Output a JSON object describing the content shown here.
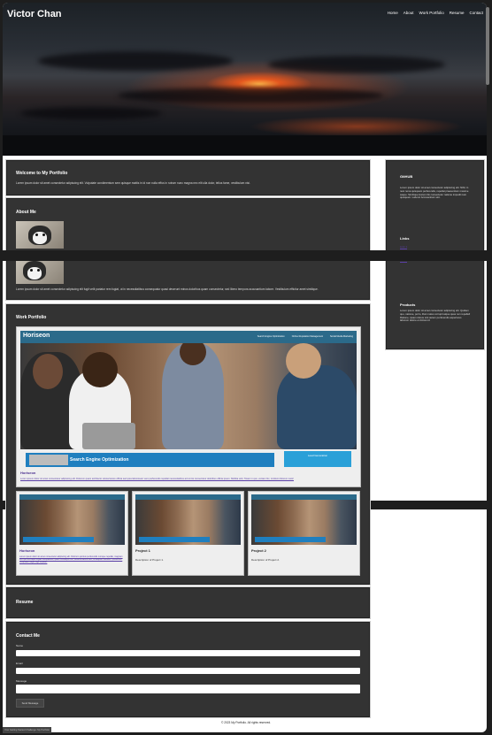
{
  "site": {
    "brand": "Victor Chan",
    "nav": [
      "Home",
      "About",
      "Work Portfolio",
      "Resume",
      "Contact"
    ]
  },
  "welcome": {
    "title": "Welcome to My Portfolio",
    "text": "Lorem ipsum dolor sit amet consectetur adipiscing elit. Vulputate condimentum sem quisque mattis in id non nulla effus in rutrum nunc magna nec elit ulla dolor, tellus fame, vestibulum nisi."
  },
  "about": {
    "title": "About Me",
    "text": "Lorem ipsum dolor sit amet consectetur adipiscing elit fugit velit pariatur rem fugiat, ut in necessitatibus consequatur quasi deserunt minus doloribus quam consectetur, sed libero tempora accusantium labore. Vestibulum efficitur amet similique."
  },
  "sidebar": {
    "github_title": "GitHUB",
    "github_text": "Lorem ipsum dolor sit amet consectetur adipiscing elit. Nihil, in nesi rema quisquam perferendis, repellat praesentium maxime saepe. Similique Harum illo consectetur natione impedit nam quisquam. Labore! Accusantium sint.",
    "links_title": "Links",
    "links": [
      "Link 1",
      "Link 2",
      "Link 3",
      "Link 4"
    ],
    "products_title": "Products",
    "products_text": "Lorem ipsum dolor sit amet consectetur adipiscing elit. Quidem quo, natione, porro, illum natus corrupti atque quas non repellat! Ratione, ipsam dolore sint autem perferendis asperiores laborum dolore et dictorum!"
  },
  "portfolio": {
    "title": "Work Portfolio",
    "shot_brand": "Horiseon",
    "shot_nav": [
      "Search Engine Optimization",
      "Online Reputation Management",
      "Social Media Marketing"
    ],
    "shot_cta": "Search Engine Optimization",
    "shot_cta2": "Lead Generation",
    "featured_name": "Horiseon",
    "featured_text": "Lorem ipsum dolor sit amet consectetur adipiscing elit. Dolorum quam architecto soluta facere officia sed quia laboriosam vero perferendis repellat necessitatibus ad omnis consectetur doloribus officia ipsum. Mollitia velit, Totam in quo, veniam hic, incidunt dolorem iusto!",
    "projects": [
      {
        "name": "Horiseon",
        "desc": "Lorem ipsum dolor sit amet consectetur adipiscing elit. Dolorum quintus perferendis cumque repellat, magnam sint quo similique fugiat voluptatibus, quam consequi nihil, dolores labore iure, sit adipisci dolorem, possimus? Voluptate magni fugit impedit."
      },
      {
        "name": "Project 1",
        "desc": "Description of Project 1."
      },
      {
        "name": "Project 2",
        "desc": "Description of Project 2."
      }
    ]
  },
  "resume": {
    "title": "Resume"
  },
  "contact": {
    "title": "Contact Me",
    "name_label": "Name",
    "email_label": "Email",
    "message_label": "Message",
    "send_label": "Send Message"
  },
  "footer": {
    "copyright": "© 2023 My Portfolio. All rights reserved.",
    "status": "Your Getting Started Challenge: My Portfolio"
  }
}
